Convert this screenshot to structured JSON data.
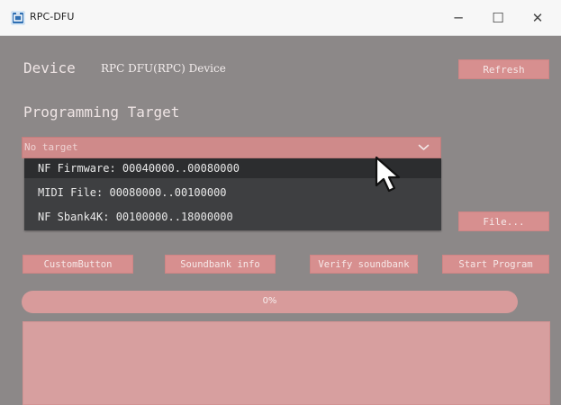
{
  "window": {
    "title": "RPC-DFU",
    "minimize_label": "─",
    "maximize_label": "☐",
    "close_label": "✕"
  },
  "device": {
    "label": "Device",
    "name": "RPC DFU(RPC) Device"
  },
  "buttons": {
    "refresh": "Refresh",
    "file": "File...",
    "custom": "CustomButton",
    "soundbank_info": "Soundbank info",
    "verify_soundbank": "Verify soundbank",
    "start_program": "Start Program"
  },
  "programming_target": {
    "label": "Programming Target",
    "selected_value": "No target",
    "options": [
      "NF Firmware: 00040000..00080000",
      "MIDI File: 00080000..00100000",
      "NF Sbank4K: 00100000..18000000"
    ]
  },
  "progress": {
    "value": 0,
    "text": "0%"
  },
  "colors": {
    "accent": "#d78f8f",
    "dropdown": "#3e3f41",
    "background": "#8c8888"
  },
  "icons": {
    "app": "rpc-dfu-app-icon",
    "chevron": "chevron-down-icon",
    "cursor": "mouse-pointer-icon"
  }
}
